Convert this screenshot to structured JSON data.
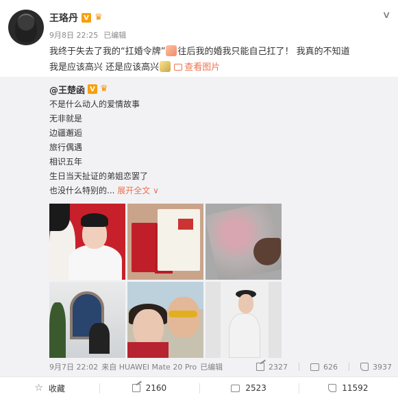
{
  "post": {
    "author": "王珞丹",
    "date": "9月8日 22:25",
    "edited": "已编辑",
    "text_line1_a": "我终于失去了我的“扛婚令牌”",
    "text_line1_b": "往后我的婚我只能自己扛了！ 我真的不知道",
    "text_line2": "我是应该高兴 还是应该高兴",
    "view_images": "查看图片"
  },
  "repost": {
    "author": "王楚函",
    "lines": [
      "不是什么动人的爱情故事",
      "无非就是",
      "边疆邂逅",
      "旅行偶遇",
      "相识五年",
      "生日当天扯证的弟姐恋罢了",
      "也没什么特别的..."
    ],
    "expand": "展开全文",
    "footer": {
      "date": "9月7日 22:02",
      "source": "来自 HUAWEI Mate 20 Pro",
      "edited": "已编辑",
      "reposts": "2327",
      "comments": "626",
      "likes": "3937"
    }
  },
  "actions": {
    "collect": "收藏",
    "repost": "2160",
    "comment": "2523",
    "like": "11592"
  },
  "colors": {
    "accent": "#eb7350",
    "badge": "#f7a00b",
    "repost_bg": "#f2f2f5"
  },
  "icons": [
    "chevron-down-icon",
    "verified-icon",
    "crown-icon",
    "image-icon",
    "share-icon",
    "comment-icon",
    "like-icon",
    "star-icon"
  ]
}
